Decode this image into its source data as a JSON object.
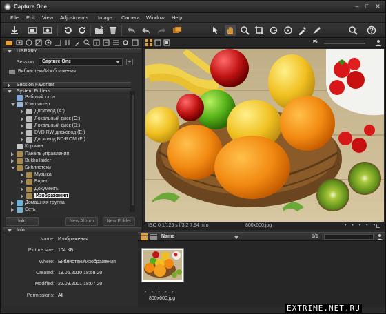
{
  "app": {
    "title": "Capture One"
  },
  "menu": [
    "File",
    "Edit",
    "View",
    "Adjustments",
    "Image",
    "Camera",
    "Window",
    "Help"
  ],
  "library": {
    "header": "LIBRARY",
    "session_label": "Session",
    "session_value": "Capture One",
    "path": "Библиотеки\\Изображения",
    "favorites_header": "Session Favorites",
    "system_header": "System Folders",
    "tree": [
      {
        "label": "Рабочий стол",
        "level": 0,
        "expand": "none",
        "icon": "desktop-icon"
      },
      {
        "label": "Компьютер",
        "level": 0,
        "expand": "open",
        "icon": "computer-icon"
      },
      {
        "label": "Дисковод (A:)",
        "level": 1,
        "expand": "closed",
        "icon": "drive-icon"
      },
      {
        "label": "Локальный диск (C:)",
        "level": 1,
        "expand": "closed",
        "icon": "drive-icon"
      },
      {
        "label": "Локальный диск (D:)",
        "level": 1,
        "expand": "closed",
        "icon": "drive-icon"
      },
      {
        "label": "DVD RW дисковод (E:)",
        "level": 1,
        "expand": "closed",
        "icon": "drive-icon"
      },
      {
        "label": "Дисковод BD-ROM (F:)",
        "level": 1,
        "expand": "closed",
        "icon": "drive-icon"
      },
      {
        "label": "Корзина",
        "level": 0,
        "expand": "none",
        "icon": "trash-icon"
      },
      {
        "label": "Панель управления",
        "level": 0,
        "expand": "closed",
        "icon": "folder-icon"
      },
      {
        "label": "Bukkollaider",
        "level": 0,
        "expand": "closed",
        "icon": "folder-icon"
      },
      {
        "label": "Библиотеки",
        "level": 0,
        "expand": "open",
        "icon": "folder-icon"
      },
      {
        "label": "Музыка",
        "level": 1,
        "expand": "closed",
        "icon": "folder-icon"
      },
      {
        "label": "Видео",
        "level": 1,
        "expand": "closed",
        "icon": "folder-icon"
      },
      {
        "label": "Документы",
        "level": 1,
        "expand": "closed",
        "icon": "folder-icon"
      },
      {
        "label": "Изображения",
        "level": 1,
        "expand": "closed",
        "icon": "folder-icon",
        "selected": true
      },
      {
        "label": "Домашняя группа",
        "level": 0,
        "expand": "closed",
        "icon": "group-icon"
      },
      {
        "label": "Сеть",
        "level": 0,
        "expand": "closed",
        "icon": "network-icon"
      }
    ],
    "buttons": {
      "info": "Info",
      "new_album": "New Album",
      "new_folder": "New Folder"
    }
  },
  "info": {
    "header": "Info",
    "fields": [
      {
        "key": "Name:",
        "value": "Изображения"
      },
      {
        "key": "Picture size:",
        "value": "104 КБ"
      },
      {
        "key": "Where:",
        "value": "Библиотеки\\Изображения"
      },
      {
        "key": "Created:",
        "value": "19.06.2010 18:58:20"
      },
      {
        "key": "Modified:",
        "value": "22.09.2001 18:07:20"
      },
      {
        "key": "Permissions:",
        "value": "All"
      }
    ]
  },
  "viewer": {
    "fit_label": "Fit",
    "exif": "ISO 0   1/125 s   f/3.2   7.94 mm",
    "filename": "800x600.jpg"
  },
  "browser": {
    "sort_label": "Name",
    "page": "1/1",
    "thumb_label": "800x600.jpg"
  },
  "watermark": "EXTRIME.NET.RU",
  "colors": {
    "accent": "#e8a13a",
    "selected_bg": "#f0f0f0"
  }
}
